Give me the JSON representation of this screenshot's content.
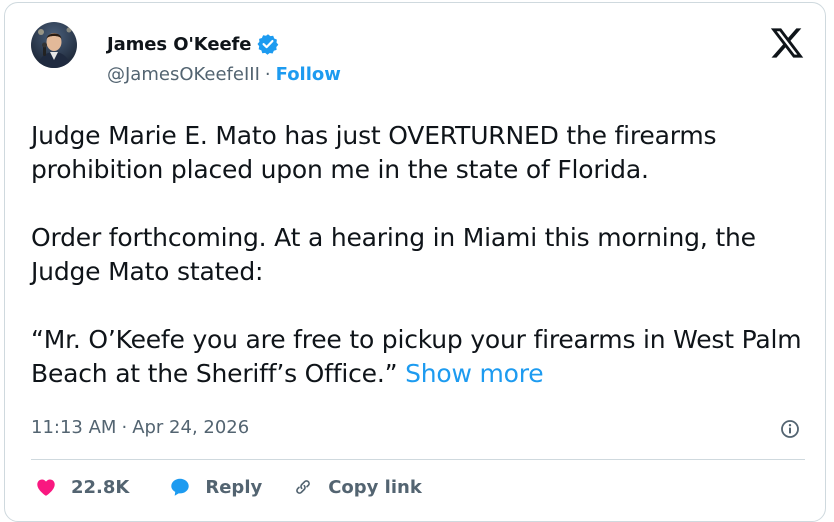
{
  "author": {
    "display_name": "James O'Keefe",
    "handle": "@JamesOKeefeIII",
    "separator": "·",
    "follow_label": "Follow",
    "verified": true,
    "verified_color": "#1d9bf0"
  },
  "brand": {
    "logo_icon": "x-logo-icon"
  },
  "tweet": {
    "paragraph_1": "Judge Marie E. Mato has just OVERTURNED the firearms prohibition placed upon me in the state of Florida.",
    "paragraph_2": "Order forthcoming. At a hearing in Miami this morning, the Judge Mato stated:",
    "paragraph_3": "“Mr. O’Keefe you are free to pickup your firearms in West Palm Beach at the Sheriff’s Office.”",
    "show_more_label": "Show more"
  },
  "meta": {
    "time": "11:13 AM",
    "separator": "·",
    "date": "Apr 24, 2026",
    "info_icon": "info-icon"
  },
  "actions": {
    "like_count": "22.8K",
    "like_icon": "heart-icon",
    "like_color": "#f91880",
    "reply_label": "Reply",
    "reply_icon": "speech-bubble-icon",
    "reply_color": "#1d9bf0",
    "copy_link_label": "Copy link",
    "copy_link_icon": "link-icon"
  },
  "colors": {
    "link": "#1d9bf0",
    "text_primary": "#0f1419",
    "text_secondary": "#536471",
    "border": "#cfd9de"
  }
}
